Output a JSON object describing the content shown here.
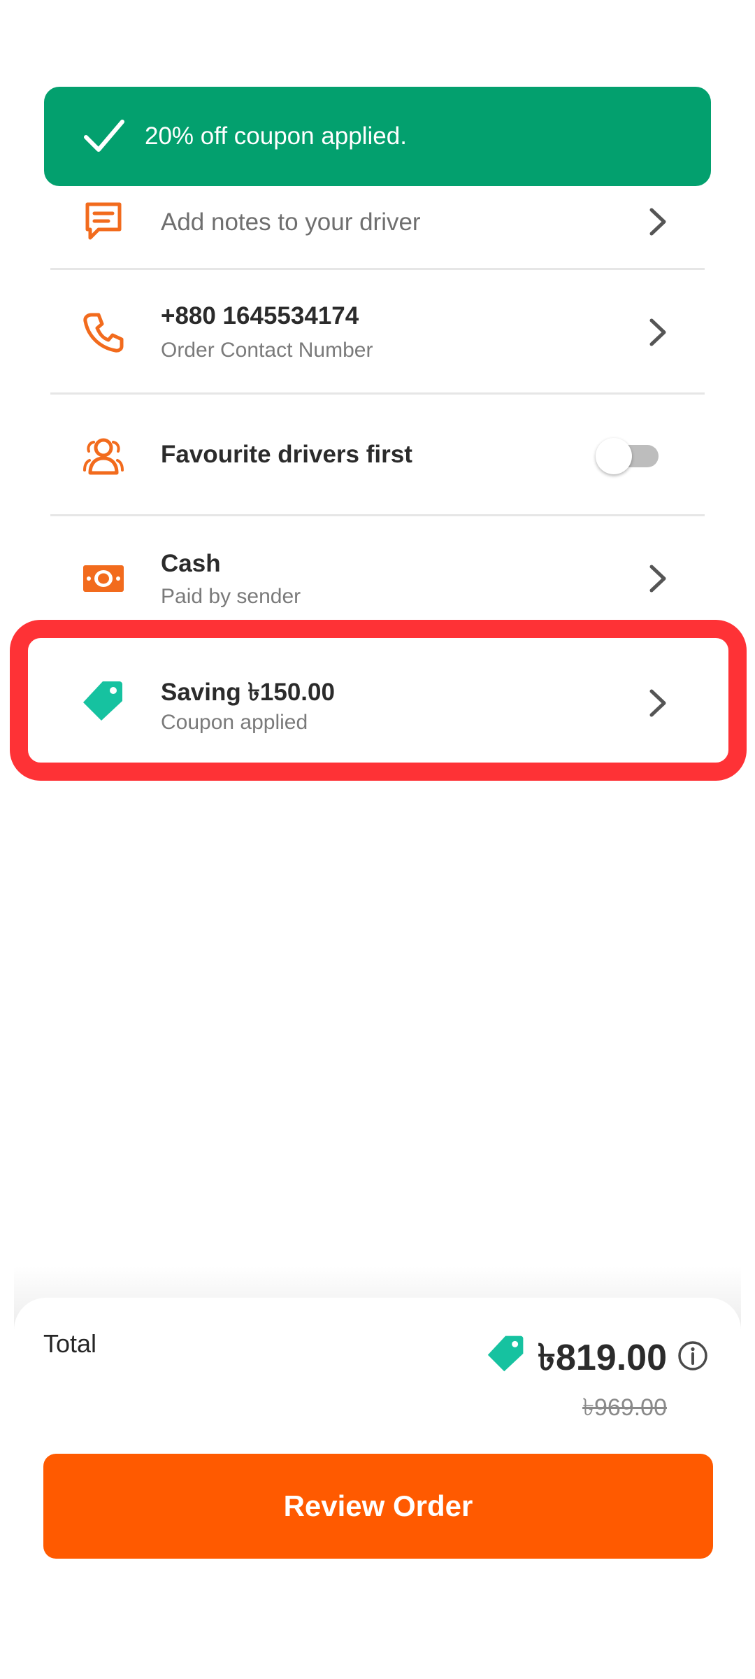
{
  "toast": {
    "icon": "check-icon",
    "message": "20% off coupon applied."
  },
  "rows": {
    "notes": {
      "icon": "chat-note-icon",
      "title": "Add notes to your driver"
    },
    "contact": {
      "icon": "phone-icon",
      "title": "+880 1645534174",
      "subtitle": "Order Contact Number"
    },
    "favourite": {
      "icon": "driver-group-icon",
      "title": "Favourite drivers first",
      "toggle_on": false
    },
    "payment": {
      "icon": "cash-icon",
      "title": "Cash",
      "subtitle": "Paid by sender"
    },
    "coupon": {
      "icon": "tag-icon",
      "title": "Saving ৳150.00",
      "subtitle": "Coupon applied"
    }
  },
  "footer": {
    "total_label": "Total",
    "total_price": "৳819.00",
    "original_price": "৳969.00",
    "review_button": "Review Order"
  },
  "colors": {
    "accent_orange": "#ff5a00",
    "icon_orange": "#f26b1d",
    "success_green": "#03a06e",
    "tag_teal": "#16c2a0",
    "highlight_red": "#fe3236"
  }
}
